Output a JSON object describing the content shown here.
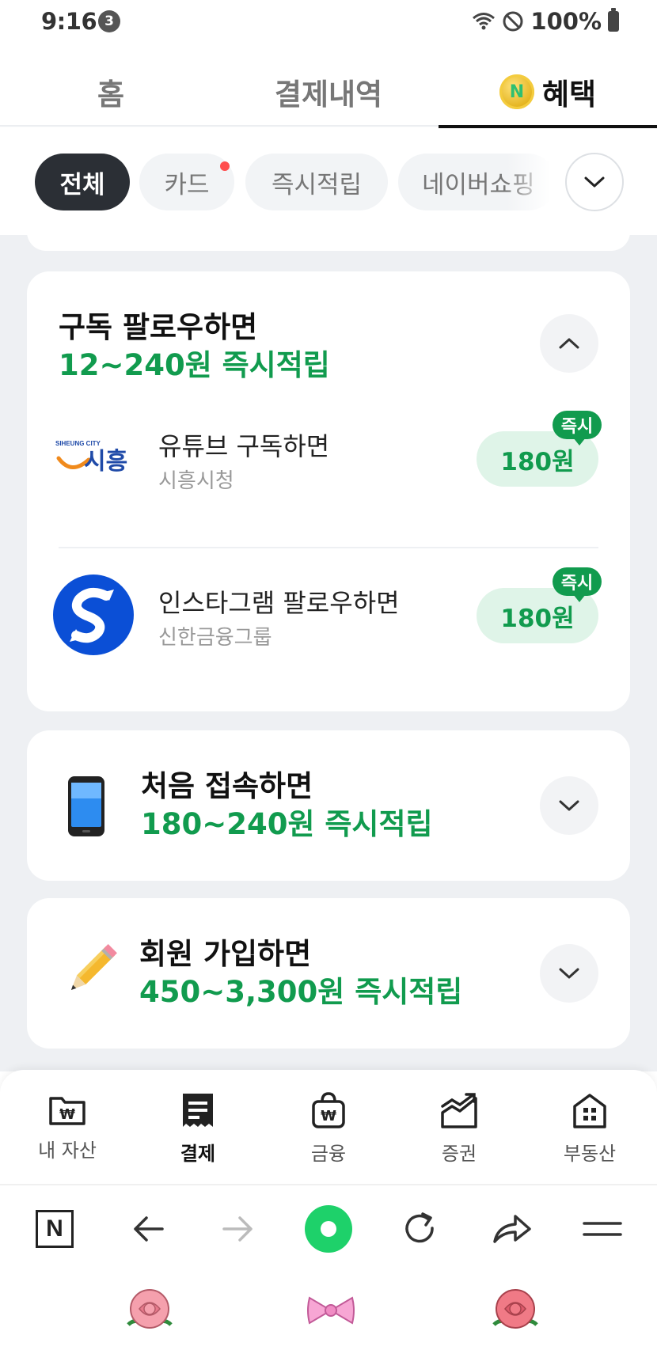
{
  "status_bar": {
    "time": "9:16",
    "notification_count": "3",
    "battery": "100%"
  },
  "top_tabs": [
    {
      "label": "홈",
      "active": false
    },
    {
      "label": "결제내역",
      "active": false
    },
    {
      "label": "혜택",
      "active": true
    }
  ],
  "coin_icon_letter": "N",
  "chips": [
    {
      "label": "전체",
      "active": true
    },
    {
      "label": "카드",
      "active": false,
      "has_dot": true
    },
    {
      "label": "즉시적립",
      "active": false
    },
    {
      "label": "네이버쇼핑",
      "active": false
    }
  ],
  "cards": {
    "subscribe": {
      "title": "구독 팔로우하면",
      "subtitle": "12~240원 즉시적립",
      "expanded": true,
      "items": [
        {
          "logo": "siheung-city-logo",
          "logo_text": "SIHEUNG CITY",
          "logo_mark": "시흥",
          "title": "유튜브 구독하면",
          "sub": "시흥시청",
          "reward": "180원",
          "badge": "즉시"
        },
        {
          "logo": "shinhan-logo",
          "title": "인스타그램 팔로우하면",
          "sub": "신한금융그룹",
          "reward": "180원",
          "badge": "즉시"
        }
      ]
    },
    "first_access": {
      "icon": "phone-icon",
      "title": "처음 접속하면",
      "subtitle": "180~240원 즉시적립",
      "expanded": false
    },
    "signup": {
      "icon": "pencil-icon",
      "title": "회원 가입하면",
      "subtitle": "450~3,300원 즉시적립",
      "expanded": false
    }
  },
  "bottom_nav": [
    {
      "label": "내 자산",
      "icon": "wallet-folder-icon",
      "active": false
    },
    {
      "label": "결제",
      "icon": "receipt-icon",
      "active": true
    },
    {
      "label": "금융",
      "icon": "money-bag-icon",
      "active": false
    },
    {
      "label": "증권",
      "icon": "stock-chart-icon",
      "active": false
    },
    {
      "label": "부동산",
      "icon": "building-icon",
      "active": false
    }
  ],
  "browser_bar": {
    "naver_label": "N",
    "icons": [
      "naver-home-icon",
      "back-arrow-icon",
      "forward-arrow-icon",
      "green-dot-icon",
      "refresh-icon",
      "share-icon",
      "menu-icon"
    ]
  },
  "colors": {
    "accent_green": "#119b4e",
    "reward_bg": "#dff4e8",
    "chip_active_bg": "#2b2f35",
    "page_bg": "#eef0f3"
  }
}
